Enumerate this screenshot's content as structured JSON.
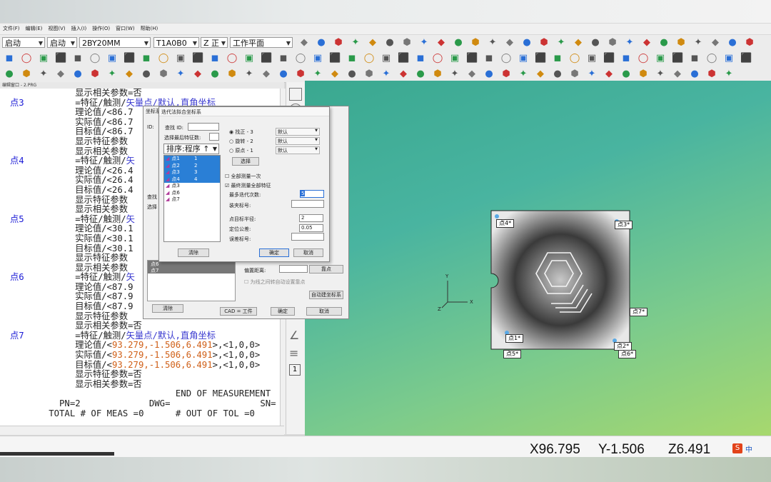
{
  "menu": [
    "文件(F)",
    "编辑(E)",
    "视图(V)",
    "插入(I)",
    "操作(O)",
    "窗口(W)",
    "帮助(H)"
  ],
  "toolbar": {
    "dd1": "启动",
    "dd2": "启动",
    "dd3": "2BY20MM",
    "dd4": "T1A0B0",
    "dd5": "Z 正",
    "dd6": "工作平面"
  },
  "editor": {
    "title": "编辑窗口 - 2.PRG",
    "lines": [
      {
        "label": "",
        "parts": [
          [
            "",
            "        显示相关参数=否"
          ]
        ]
      },
      {
        "label": "点3",
        "parts": [
          [
            "",
            "        =特征/触测/"
          ],
          [
            "blue",
            "矢量点/默认,直角坐标"
          ]
        ]
      },
      {
        "label": "",
        "parts": [
          [
            "",
            "        理论值/<86.7"
          ]
        ]
      },
      {
        "label": "",
        "parts": [
          [
            "",
            "        实际值/<86.7"
          ]
        ]
      },
      {
        "label": "",
        "parts": [
          [
            "",
            "        目标值/<86.7"
          ]
        ]
      },
      {
        "label": "",
        "parts": [
          [
            "",
            "        显示特征参数"
          ]
        ]
      },
      {
        "label": "",
        "parts": [
          [
            "",
            "        显示相关参数"
          ]
        ]
      },
      {
        "label": "点4",
        "parts": [
          [
            "",
            "        =特征/触测/"
          ],
          [
            "blue",
            "矢"
          ]
        ]
      },
      {
        "label": "",
        "parts": [
          [
            "",
            "        理论值/<26.4"
          ]
        ]
      },
      {
        "label": "",
        "parts": [
          [
            "",
            "        实际值/<26.4"
          ]
        ]
      },
      {
        "label": "",
        "parts": [
          [
            "",
            "        目标值/<26.4"
          ]
        ]
      },
      {
        "label": "",
        "parts": [
          [
            "",
            "        显示特征参数"
          ]
        ]
      },
      {
        "label": "",
        "parts": [
          [
            "",
            "        显示相关参数"
          ]
        ]
      },
      {
        "label": "点5",
        "parts": [
          [
            "",
            "        =特征/触测/"
          ],
          [
            "blue",
            "矢"
          ]
        ]
      },
      {
        "label": "",
        "parts": [
          [
            "",
            "        理论值/<30.1"
          ]
        ]
      },
      {
        "label": "",
        "parts": [
          [
            "",
            "        实际值/<30.1"
          ]
        ]
      },
      {
        "label": "",
        "parts": [
          [
            "",
            "        目标值/<30.1"
          ]
        ]
      },
      {
        "label": "",
        "parts": [
          [
            "",
            "        显示特征参数"
          ]
        ]
      },
      {
        "label": "",
        "parts": [
          [
            "",
            "        显示相关参数"
          ]
        ]
      },
      {
        "label": "点6",
        "parts": [
          [
            "",
            "        =特征/触测/"
          ],
          [
            "blue",
            "矢"
          ]
        ]
      },
      {
        "label": "",
        "parts": [
          [
            "",
            "        理论值/<87.9"
          ]
        ]
      },
      {
        "label": "",
        "parts": [
          [
            "",
            "        实际值/<87.9"
          ]
        ]
      },
      {
        "label": "",
        "parts": [
          [
            "",
            "        目标值/<87.9"
          ]
        ]
      },
      {
        "label": "",
        "parts": [
          [
            "",
            "        显示特征参数"
          ]
        ]
      },
      {
        "label": "",
        "parts": [
          [
            "",
            "        显示相关参数=否"
          ]
        ]
      },
      {
        "label": "点7",
        "parts": [
          [
            "",
            "        =特征/触测/"
          ],
          [
            "blue",
            "矢量点/默认,直角坐标"
          ]
        ]
      },
      {
        "label": "",
        "parts": [
          [
            "",
            "        理论值/<"
          ],
          [
            "org",
            "93.279,-1.506,6.491"
          ],
          [
            "",
            ">,<1,0,0>"
          ]
        ]
      },
      {
        "label": "",
        "parts": [
          [
            "",
            "        实际值/<"
          ],
          [
            "org",
            "93.279,-1.506,6.491"
          ],
          [
            "",
            ">,<1,0,0>"
          ]
        ]
      },
      {
        "label": "",
        "parts": [
          [
            "",
            "        目标值/<"
          ],
          [
            "org",
            "93.279,-1.506,6.491"
          ],
          [
            "",
            ">,<1,0,0>"
          ]
        ]
      },
      {
        "label": "",
        "parts": [
          [
            "",
            "        显示特征参数=否"
          ]
        ]
      },
      {
        "label": "",
        "parts": [
          [
            "",
            "        显示相关参数=否"
          ]
        ]
      },
      {
        "label": "",
        "parts": [
          [
            "",
            "                           END OF MEASUREMENT"
          ]
        ]
      },
      {
        "label": "",
        "parts": [
          [
            "",
            "     PN=2             DWG=                 SN="
          ]
        ]
      },
      {
        "label": "",
        "parts": [
          [
            "",
            "   TOTAL # OF MEAS =0      # OUT OF TOL =0"
          ]
        ]
      }
    ]
  },
  "backdialog": {
    "title": "坐标系",
    "find_label": "查找",
    "select_label": "选择",
    "list": [
      "点6",
      "点7"
    ],
    "offset_label": "偏置距离:",
    "check_label": "为线之间转自动设置靠点",
    "point_btn": "靠点",
    "auto_btn": "自动建坐标系",
    "clear_btn": "清除",
    "cad_btn": "CAD = 工件",
    "ok_btn": "确定",
    "cancel_btn": "取消"
  },
  "dialog": {
    "title": "迭代法拟合坐标系",
    "id_label": "ID:",
    "find_id_label": "查找 ID:",
    "select_last_label": "选择最后特征数:",
    "sort_label": "排序:程序 ↑",
    "features": [
      {
        "name": "点1",
        "num": "1",
        "selected": true
      },
      {
        "name": "点2",
        "num": "2",
        "selected": true
      },
      {
        "name": "点3",
        "num": "3",
        "selected": true
      },
      {
        "name": "点4",
        "num": "4",
        "selected": true
      },
      {
        "name": "点3",
        "num": "",
        "selected": false
      },
      {
        "name": "点6",
        "num": "",
        "selected": false
      },
      {
        "name": "点7",
        "num": "",
        "selected": false
      }
    ],
    "radios": [
      {
        "label": "找正 - 3",
        "value": "默认",
        "checked": true
      },
      {
        "label": "旋转 - 2",
        "value": "默认",
        "checked": false
      },
      {
        "label": "原点 - 1",
        "value": "默认",
        "checked": false
      }
    ],
    "select_btn": "选择",
    "check_all": "全部测量一次",
    "check_final": "最终测量全部特征",
    "max_iter_label": "最多迭代次数:",
    "max_iter_value": "5",
    "fixture_label": "装夹标号:",
    "target_radius_label": "点目标半径:",
    "target_radius_value": "2",
    "tolerance_label": "定位公差:",
    "tolerance_value": "0.05",
    "level_label": "误差标号:",
    "clear_btn": "清除",
    "ok_btn": "确定",
    "cancel_btn": "取消"
  },
  "viewport": {
    "axis_x": "X",
    "axis_y": "Y",
    "axis_z": "Z",
    "points": [
      "点4*",
      "点3*",
      "点7*",
      "点1*",
      "点2*",
      "点5*",
      "点6*"
    ]
  },
  "status": {
    "x": "X96.795",
    "y": "Y-1.506",
    "z": "Z6.491",
    "ime": "中"
  }
}
